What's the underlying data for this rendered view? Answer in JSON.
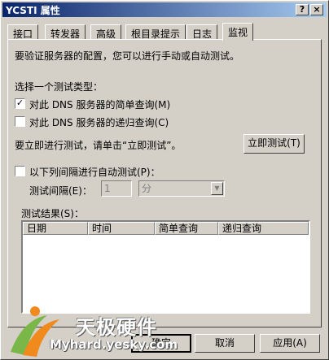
{
  "window": {
    "title": "YCSTI 属性",
    "help_glyph": "?",
    "close_glyph": "×"
  },
  "tabs": [
    {
      "label": "接口"
    },
    {
      "label": "转发器"
    },
    {
      "label": "高级"
    },
    {
      "label": "根目录提示"
    },
    {
      "label": "日志"
    },
    {
      "label": "监视"
    }
  ],
  "panel": {
    "description": "要验证服务器的配置，您可以进行手动或自动测试。",
    "test_type_label": "选择一个测试类型：",
    "checkbox_simple": {
      "label": "对此 DNS 服务器的简单查询(M)",
      "checked": true
    },
    "checkbox_recursive": {
      "label": "对此 DNS 服务器的递归查询(C)",
      "checked": false
    },
    "test_now_prompt": "要立即进行测试，请单击“立即测试”。",
    "test_now_button": "立即测试(T)",
    "auto_test": {
      "label": "以下列间隔进行自动测试(P)：",
      "checked": false
    },
    "interval_label": "测试间隔(E)：",
    "interval_value": "1",
    "interval_unit": "分",
    "results_label": "测试结果(S)：",
    "columns": [
      "日期",
      "时间",
      "简单查询",
      "递归查询"
    ]
  },
  "footer": {
    "ok": "确定",
    "cancel": "取消",
    "apply": "应用(A)"
  },
  "watermark": {
    "title": "天极硬件",
    "url": "Myhard.yesky.com"
  },
  "colors": {
    "face": "#d4d0c8",
    "title_start": "#0a246a",
    "title_end": "#a6caf0"
  }
}
